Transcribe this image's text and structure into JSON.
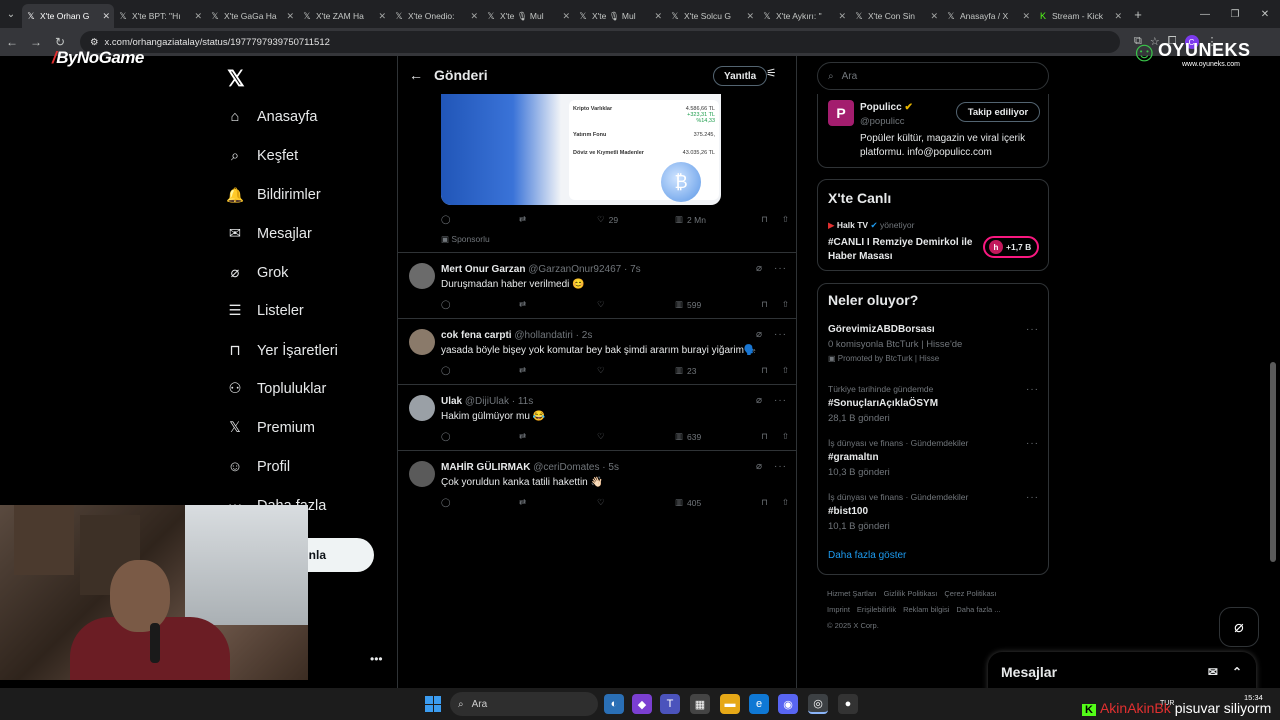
{
  "browser": {
    "tabs": [
      {
        "label": "X'te Orhan G",
        "active": true
      },
      {
        "label": "X'te BPT: \"Hı"
      },
      {
        "label": "X'te GaGa Ha"
      },
      {
        "label": "X'te ZAM Ha"
      },
      {
        "label": "X'te Onedio:"
      },
      {
        "label": "X'te 🎙 Mul"
      },
      {
        "label": "X'te 🎙 Mul"
      },
      {
        "label": "X'te Solcu G"
      },
      {
        "label": "X'te Aykırı: \""
      },
      {
        "label": "X'te Con Sin"
      },
      {
        "label": "Anasayfa / X"
      },
      {
        "label": "Stream - Kick"
      }
    ],
    "url": "x.com/orhangaziatalay/status/1977797939750711512"
  },
  "overlays": {
    "bynogame": "ByNoGame",
    "oyuneks_word": "OYUNEKS",
    "oyuneks_site": "www.oyuneks.com",
    "ticker_user": "AkinAkinBk",
    "ticker_msg": "pisuvar siliyorm"
  },
  "nav": {
    "items": [
      "Anasayfa",
      "Keşfet",
      "Bildirimler",
      "Mesajlar",
      "Grok",
      "Listeler",
      "Yer İşaretleri",
      "Topluluklar",
      "Premium",
      "Profil",
      "Daha fazla"
    ],
    "post_label": "ayınla"
  },
  "post": {
    "title": "Gönderi",
    "reply_label": "Yanıtla",
    "ad": {
      "card_rows": [
        "Kripto Varlıklar",
        "Yatırım Fonu",
        "Döviz ve Kıymetli Madenler"
      ],
      "card_values": [
        "4.586,66 TL",
        "375.245,",
        "43.035,26 TL"
      ],
      "card_sub": [
        "+323,31 TL",
        "%14,33"
      ],
      "likes": "29",
      "views": "2 Mn",
      "sponsored": "Sponsorlu"
    }
  },
  "replies": [
    {
      "name": "Mert Onur Garzan",
      "handle": "@GarzanOnur92467 · 7s",
      "text": "Duruşmadan haber verilmedi 😊",
      "views": "599",
      "avatar_color": "#6b6b6b"
    },
    {
      "name": "cok fena carpti",
      "handle": "@hollandatiri · 2s",
      "text": "yasada böyle bişey yok komutar bey bak şimdi ararım burayi yiğarim🗣️",
      "views": "23",
      "avatar_color": "#8a7a6a"
    },
    {
      "name": "Ulak",
      "handle": "@DijiUlak · 11s",
      "text": "Hakim gülmüyor mu 😂",
      "views": "639",
      "avatar_color": "#9aa0a6"
    },
    {
      "name": "MAHİR GÜLIRMAK",
      "handle": "@ceriDomates · 5s",
      "text": "Çok yoruldun kanka tatili hakettin 👋🏻",
      "views": "405",
      "avatar_color": "#5a5a5a"
    }
  ],
  "right": {
    "search_placeholder": "Ara",
    "populicc": {
      "name": "Populicc",
      "handle": "@populicc",
      "bio": "Popüler kültür, magazin ve viral içerik platformu. info@populicc.com",
      "follow_label": "Takip ediliyor"
    },
    "live": {
      "title": "X'te Canlı",
      "host": "Halk TV",
      "host_suffix": "yönetiyor",
      "text": "#CANLI I Remziye Demirkol ile Haber Masası",
      "count": "+1,7 B"
    },
    "trends_title": "Neler oluyor?",
    "trends": [
      {
        "meta": "",
        "name": "GörevimizABDBorsası",
        "sub": "0 komisyonla BtcTurk | Hisse'de",
        "promo": "Promoted by BtcTurk | Hisse"
      },
      {
        "meta": "Türkiye tarihinde gündemde",
        "name": "#SonuçlarıAçıklaÖSYM",
        "sub": "28,1 B gönderi"
      },
      {
        "meta": "İş dünyası ve finans · Gündemdekiler",
        "name": "#gramaltın",
        "sub": "10,3 B gönderi"
      },
      {
        "meta": "İş dünyası ve finans · Gündemdekiler",
        "name": "#bist100",
        "sub": "10,1 B gönderi"
      }
    ],
    "show_more": "Daha fazla göster",
    "footer": [
      "Hizmet Şartları",
      "Gizlilik Politikası",
      "Çerez Politikası",
      "Imprint",
      "Erişilebilirlik",
      "Reklam bilgisi",
      "Daha fazla ...",
      "© 2025 X Corp."
    ],
    "messages_label": "Mesajlar"
  },
  "taskbar": {
    "search": "Ara",
    "lang": "TUR",
    "time": "15:34"
  },
  "colors": {
    "accent": "#1d9bf0",
    "bg": "#000000",
    "border": "#2f3336",
    "muted": "#71767b"
  }
}
